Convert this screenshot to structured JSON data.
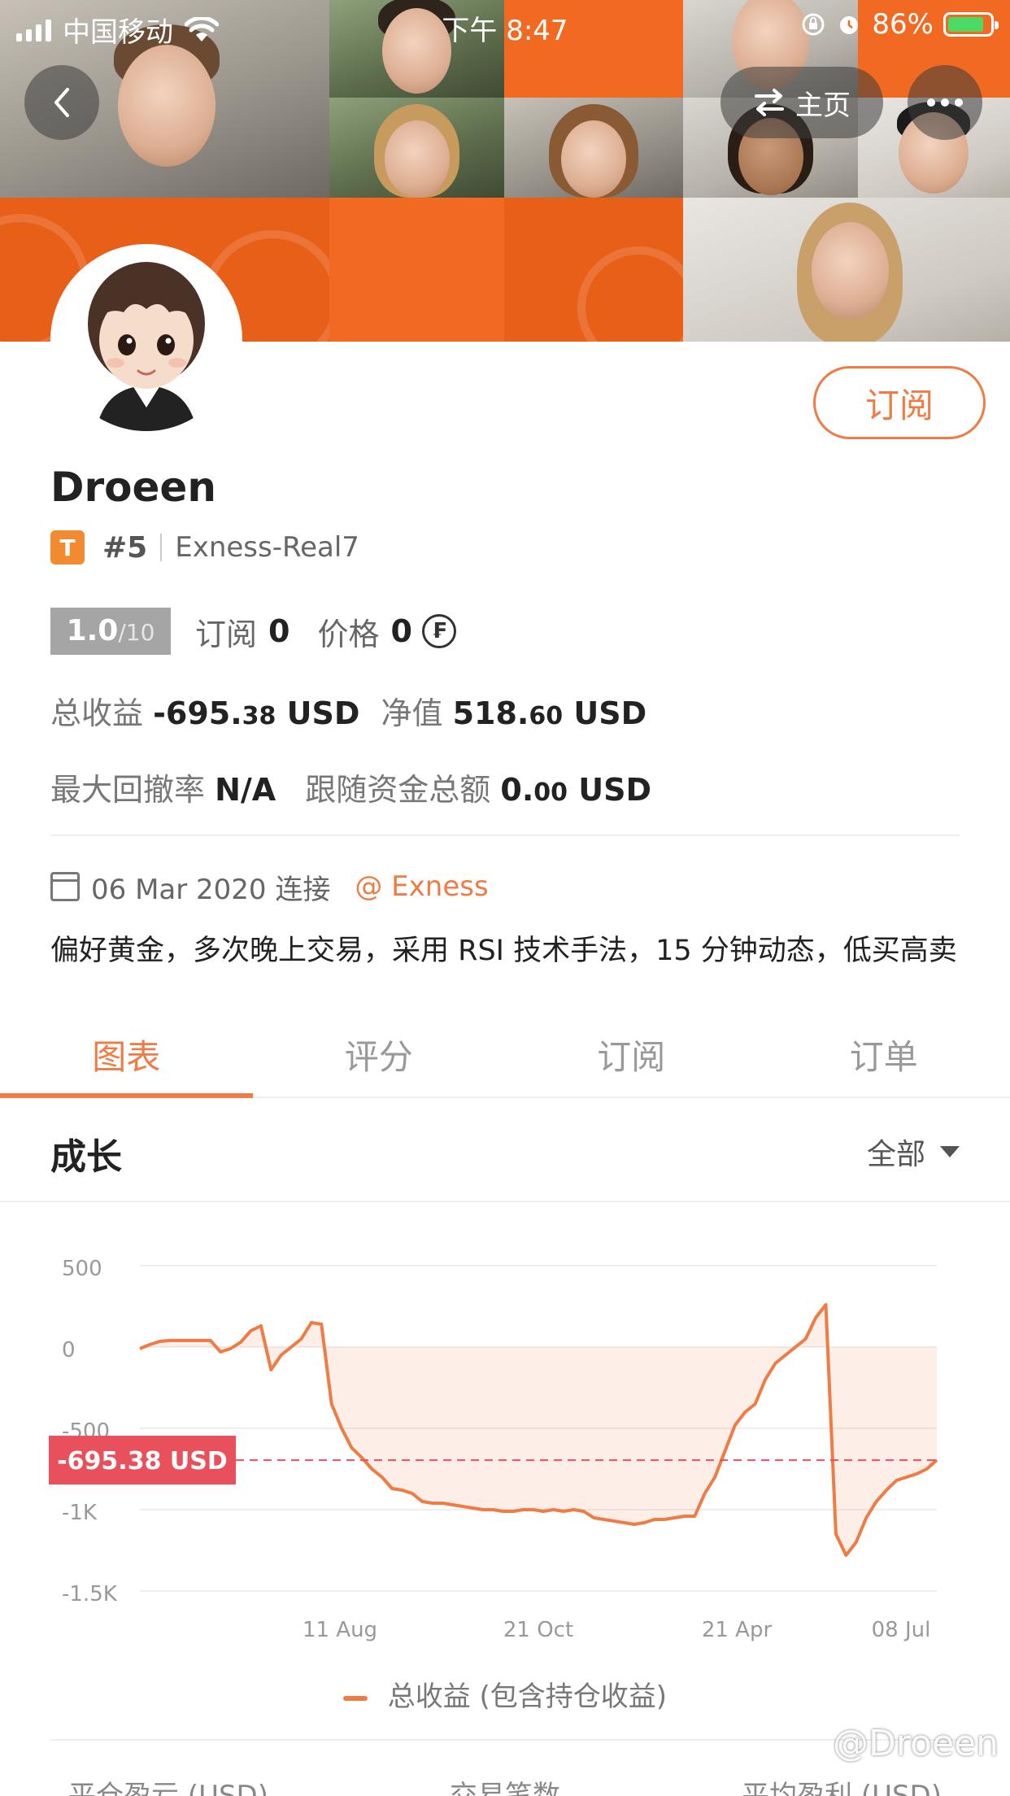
{
  "status_bar": {
    "carrier": "中国移动",
    "time": "下午 8:47",
    "battery": "86%",
    "battery_level": 0.86
  },
  "nav": {
    "homepage_label": "主页",
    "back_icon": "chevron-left-icon",
    "swap_icon": "swap-arrows-icon",
    "more_icon": "more-dots-icon"
  },
  "profile": {
    "subscribe_button": "订阅",
    "name": "Droeen",
    "badge": "T",
    "rank": "#5",
    "account": "Exness-Real7",
    "score_value": "1.0",
    "score_max": "/10",
    "subscribers_label": "订阅",
    "subscribers_value": "0",
    "price_label": "价格",
    "price_value": "0",
    "coin_symbol": "₣",
    "total_profit_label": "总收益",
    "total_profit_main": "-695.",
    "total_profit_cents": "38",
    "total_profit_unit": "USD",
    "equity_label": "净值",
    "equity_main": "518.",
    "equity_cents": "60",
    "equity_unit": "USD",
    "max_drawdown_label": "最大回撤率",
    "max_drawdown_value": "N/A",
    "follow_funds_label": "跟随资金总额",
    "follow_funds_main": "0.",
    "follow_funds_cents": "00",
    "follow_funds_unit": "USD",
    "connected_date": "06 Mar 2020 连接",
    "broker_link": "@ Exness",
    "description": "偏好黄金，多次晚上交易，采用 RSI 技术手法，15 分钟动态，低买高卖"
  },
  "tabs": [
    "图表",
    "评分",
    "订阅",
    "订单"
  ],
  "active_tab": 0,
  "growth": {
    "title": "成长",
    "filter": "全部"
  },
  "chart_data": {
    "type": "area",
    "y_ticks": [
      "500",
      "0",
      "-500",
      "-1K",
      "-1.5K"
    ],
    "ylim": [
      -1500,
      500
    ],
    "x_ticks": [
      "11 Aug",
      "21 Oct",
      "21 Apr",
      "08 Jul"
    ],
    "current_label": "-695.38 USD",
    "current_value": -695.38,
    "legend": "总收益 (包含持仓收益)",
    "line_color": "#ef7b45",
    "marker_color": "#e8505b",
    "series": [
      {
        "name": "总收益 (包含持仓收益)",
        "values": [
          -10,
          15,
          35,
          40,
          40,
          40,
          40,
          40,
          -30,
          -10,
          30,
          100,
          130,
          -140,
          -50,
          0,
          50,
          150,
          140,
          -350,
          -500,
          -620,
          -680,
          -750,
          -800,
          -870,
          -880,
          -900,
          -950,
          -960,
          -960,
          -970,
          -980,
          -990,
          -1000,
          -1000,
          -1010,
          -1010,
          -1000,
          -1000,
          -1010,
          -1000,
          -1010,
          -1000,
          -1010,
          -1050,
          -1060,
          -1070,
          -1080,
          -1090,
          -1080,
          -1060,
          -1060,
          -1050,
          -1040,
          -1040,
          -900,
          -800,
          -640,
          -480,
          -400,
          -350,
          -200,
          -100,
          -50,
          0,
          50,
          180,
          260,
          -1150,
          -1280,
          -1200,
          -1050,
          -950,
          -880,
          -820,
          -800,
          -780,
          -750,
          -695
        ]
      }
    ]
  },
  "bottom_stats": [
    "平仓盈亏 (USD)",
    "交易笔数",
    "平均盈利 (USD)"
  ],
  "watermark": "@Droeen"
}
